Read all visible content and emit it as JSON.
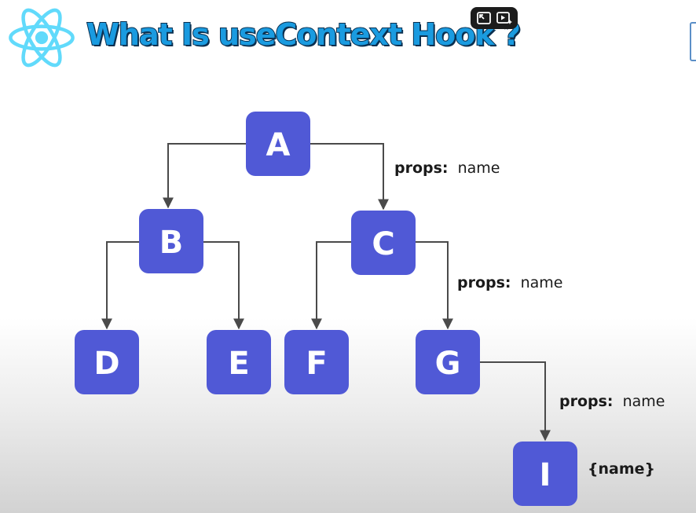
{
  "header": {
    "title": "What Is useContext Hook ?",
    "logo_icon": "react-atom-icon",
    "logo_color": "#61dafb",
    "title_color": "#1a9be0"
  },
  "video_controls": {
    "icons": [
      "exit-fullscreen-icon",
      "video-sparkle-icon"
    ]
  },
  "diagram": {
    "node_color": "#5059d6",
    "nodes": [
      {
        "id": "A",
        "label": "A"
      },
      {
        "id": "B",
        "label": "B"
      },
      {
        "id": "C",
        "label": "C"
      },
      {
        "id": "D",
        "label": "D"
      },
      {
        "id": "E",
        "label": "E"
      },
      {
        "id": "F",
        "label": "F"
      },
      {
        "id": "G",
        "label": "G"
      },
      {
        "id": "I",
        "label": "I"
      }
    ],
    "edges": [
      {
        "from": "A",
        "to": "B"
      },
      {
        "from": "A",
        "to": "C",
        "label_key": "props:",
        "label_value": "name"
      },
      {
        "from": "B",
        "to": "D"
      },
      {
        "from": "B",
        "to": "E"
      },
      {
        "from": "C",
        "to": "F"
      },
      {
        "from": "C",
        "to": "G",
        "label_key": "props:",
        "label_value": "name"
      },
      {
        "from": "G",
        "to": "I",
        "label_key": "props:",
        "label_value": "name"
      }
    ],
    "consumer_label": "{name}"
  }
}
